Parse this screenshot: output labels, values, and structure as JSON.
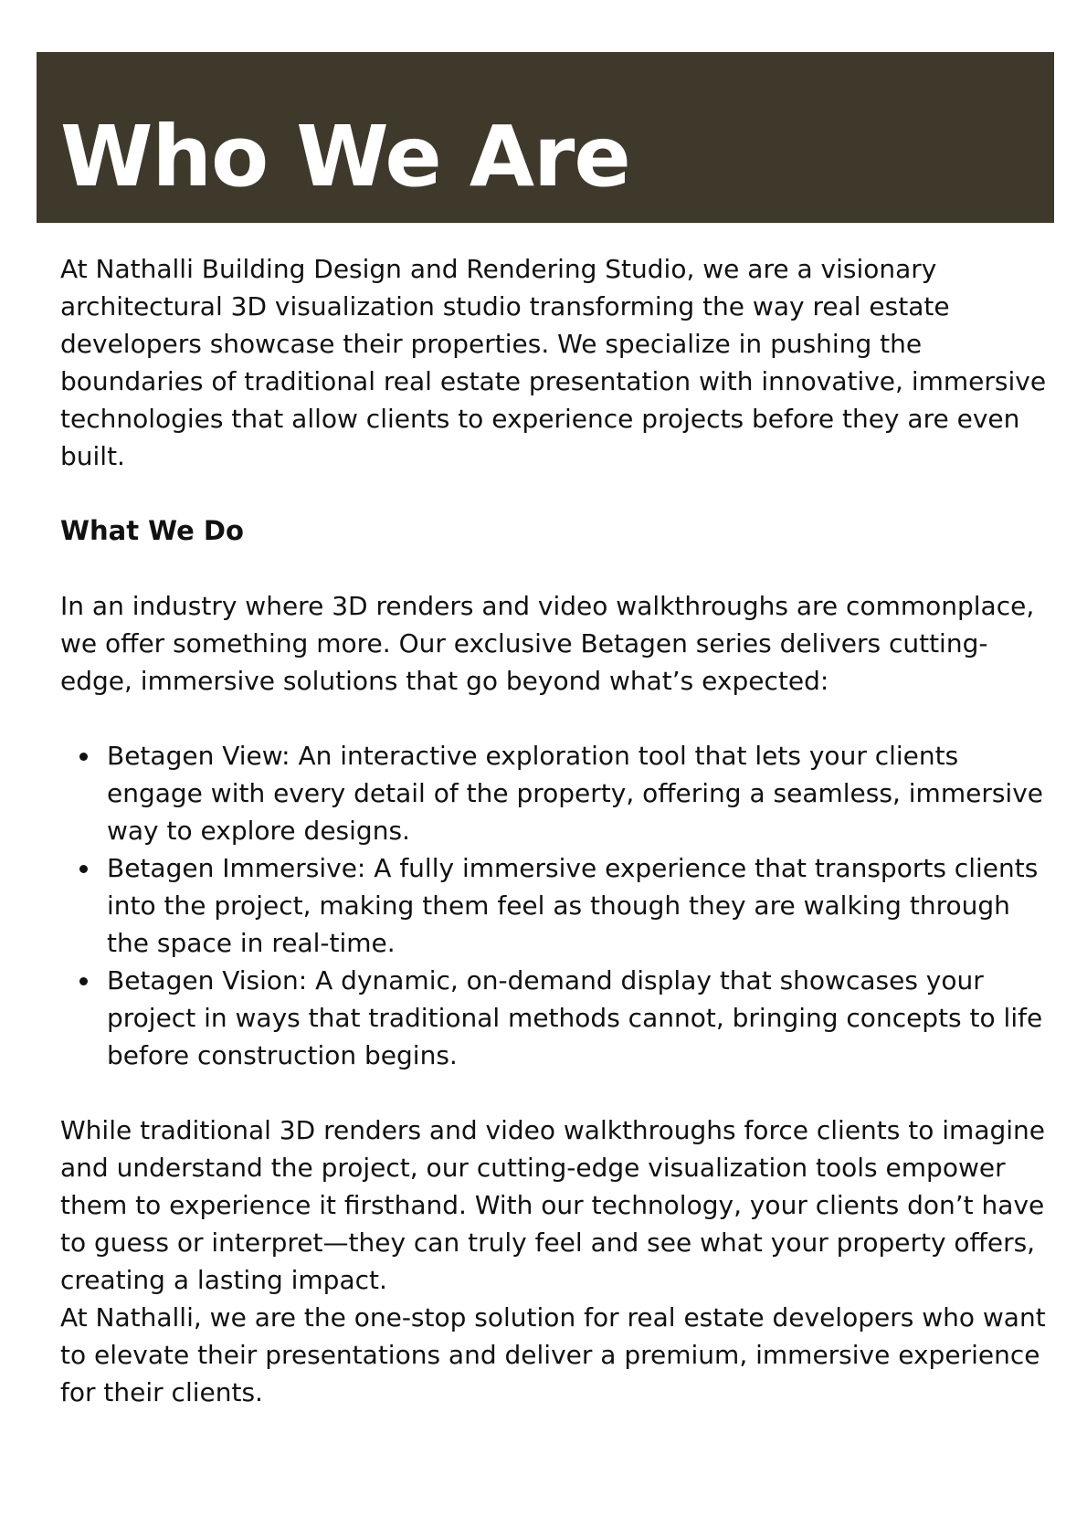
{
  "header": {
    "title": "Who We Are"
  },
  "intro": "At Nathalli Building Design and Rendering Studio, we are a visionary architectural 3D visualization studio transforming the way real estate developers showcase their properties. We specialize in pushing the boundaries of traditional real estate presentation with innovative, immersive technologies that allow clients to experience projects before they are even built.",
  "section": {
    "heading": "What We Do",
    "lead": "In an industry where 3D renders and video walkthroughs are commonplace, we offer something more. Our exclusive Betagen series delivers cutting-edge, immersive solutions that go beyond what’s expected:",
    "bullets": [
      "Betagen View: An interactive exploration tool that lets your clients engage with every detail of the property, offering a seamless, immersive way to explore designs.",
      "Betagen Immersive: A fully immersive experience that transports clients into the project, making them feel as though they are walking through the space in real-time.",
      "Betagen Vision: A dynamic, on-demand display that showcases your project in ways that traditional methods cannot, bringing concepts to life before construction begins."
    ],
    "closing_1": "While traditional 3D renders and video walkthroughs force clients to imagine and understand the project, our cutting-edge visualization tools empower them to experience it firsthand. With our technology, your clients don’t have to guess or interpret—they can truly feel and see what your property offers, creating a lasting impact.",
    "closing_2": "At Nathalli, we are the one-stop solution for real estate developers who want to elevate their presentations and deliver a premium, immersive experience for their clients."
  },
  "colors": {
    "banner": "#3f392c",
    "title_text": "#ffffff",
    "body_text": "#111111"
  }
}
